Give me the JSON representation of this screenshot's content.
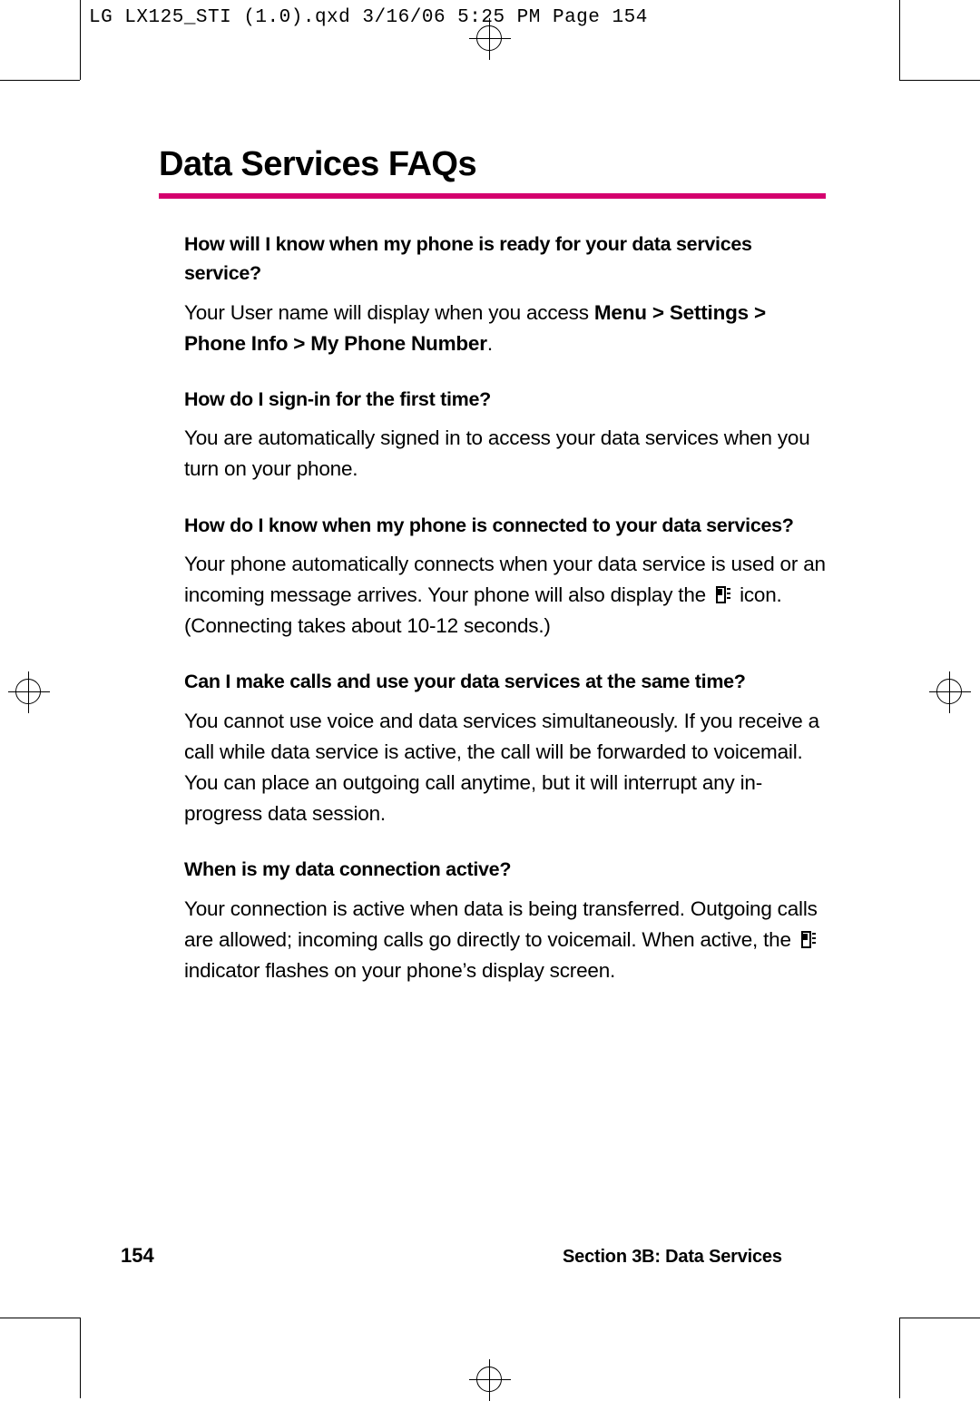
{
  "file_header": "LG LX125_STI (1.0).qxd  3/16/06  5:25 PM  Page 154",
  "title": "Data Services FAQs",
  "accent_color": "#d4006e",
  "faqs": [
    {
      "question": "How will I know when my phone is ready for your data services service?",
      "answer_parts": [
        {
          "text": "Your User name will display when you access ",
          "bold": false
        },
        {
          "text": "Menu > Settings > Phone Info > My Phone Number",
          "bold": true
        },
        {
          "text": ".",
          "bold": false
        }
      ]
    },
    {
      "question": "How do I sign-in for the first time?",
      "answer_parts": [
        {
          "text": "You are automatically signed in to access your data services when you turn on your phone.",
          "bold": false
        }
      ]
    },
    {
      "question": "How do I know when my phone is connected to your data services?",
      "answer_parts": [
        {
          "text": "Your phone automatically connects when your data service is used or an incoming message arrives. Your phone will also display the ",
          "bold": false
        },
        {
          "icon": "data-connection-icon"
        },
        {
          "text": " icon. (Connecting takes about 10-12 seconds.)",
          "bold": false
        }
      ]
    },
    {
      "question": "Can I make calls and use your data services at the same time?",
      "answer_parts": [
        {
          "text": "You cannot use voice and data services simultaneously. If you receive a call while data service is active, the call will be forwarded to voicemail. You can place an outgoing call anytime, but it will interrupt any in-progress data session.",
          "bold": false
        }
      ]
    },
    {
      "question": "When is my data connection active?",
      "answer_parts": [
        {
          "text": "Your connection is active when data is being transferred. Outgoing calls are allowed; incoming calls go directly to voicemail. When active, the ",
          "bold": false
        },
        {
          "icon": "data-connection-icon"
        },
        {
          "text": " indicator flashes on your phone’s display screen.",
          "bold": false
        }
      ]
    }
  ],
  "footer": {
    "page_number": "154",
    "section": "Section 3B: Data Services"
  }
}
